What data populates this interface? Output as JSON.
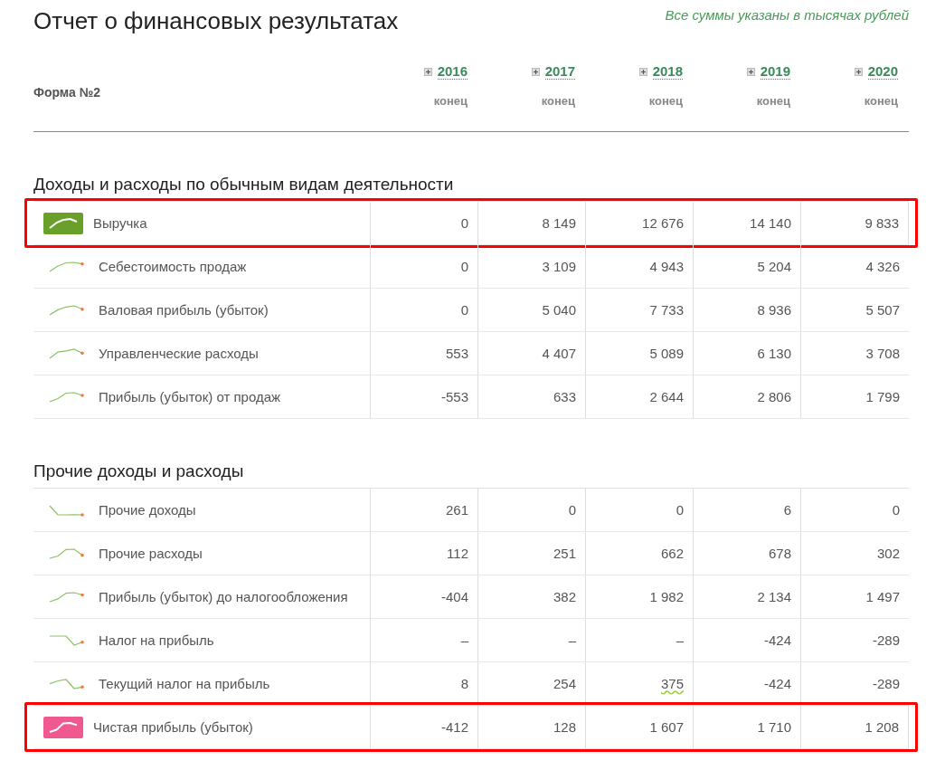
{
  "note": "Все суммы указаны в тысячах рублей",
  "title": "Отчет о финансовых результатах",
  "form_label": "Форма №2",
  "columns": [
    {
      "year": "2016",
      "period": "конец"
    },
    {
      "year": "2017",
      "period": "конец"
    },
    {
      "year": "2018",
      "period": "конец"
    },
    {
      "year": "2019",
      "period": "конец"
    },
    {
      "year": "2020",
      "period": "конец"
    }
  ],
  "sections": [
    {
      "title": "Доходы и расходы по обычным видам деятельности",
      "rows": [
        {
          "label": "Выручка",
          "highlighted": true,
          "color": "#6a9f2a",
          "values": [
            "0",
            "8 149",
            "12 676",
            "14 140",
            "9 833"
          ]
        },
        {
          "label": "Себестоимость продаж",
          "highlighted": false,
          "values": [
            "0",
            "3 109",
            "4 943",
            "5 204",
            "4 326"
          ]
        },
        {
          "label": "Валовая прибыль (убыток)",
          "highlighted": false,
          "values": [
            "0",
            "5 040",
            "7 733",
            "8 936",
            "5 507"
          ]
        },
        {
          "label": "Управленческие расходы",
          "highlighted": false,
          "values": [
            "553",
            "4 407",
            "5 089",
            "6 130",
            "3 708"
          ]
        },
        {
          "label": "Прибыль (убыток) от продаж",
          "highlighted": false,
          "values": [
            "-553",
            "633",
            "2 644",
            "2 806",
            "1 799"
          ]
        }
      ]
    },
    {
      "title": "Прочие доходы и расходы",
      "rows": [
        {
          "label": "Прочие доходы",
          "highlighted": false,
          "values": [
            "261",
            "0",
            "0",
            "6",
            "0"
          ]
        },
        {
          "label": "Прочие расходы",
          "highlighted": false,
          "values": [
            "112",
            "251",
            "662",
            "678",
            "302"
          ]
        },
        {
          "label": "Прибыль (убыток) до налогообложения",
          "highlighted": false,
          "values": [
            "-404",
            "382",
            "1 982",
            "2 134",
            "1 497"
          ]
        },
        {
          "label": "Налог на прибыль",
          "highlighted": false,
          "values": [
            "–",
            "–",
            "–",
            "-424",
            "-289"
          ]
        },
        {
          "label": "Текущий налог на прибыль",
          "highlighted": false,
          "values": [
            "8",
            "254",
            "375",
            "-424",
            "-289"
          ],
          "spell_marks": [
            false,
            false,
            true,
            false,
            false
          ]
        },
        {
          "label": "Чистая прибыль (убыток)",
          "highlighted": true,
          "color": "#f0598f",
          "values": [
            "-412",
            "128",
            "1 607",
            "1 710",
            "1 208"
          ]
        }
      ]
    }
  ]
}
